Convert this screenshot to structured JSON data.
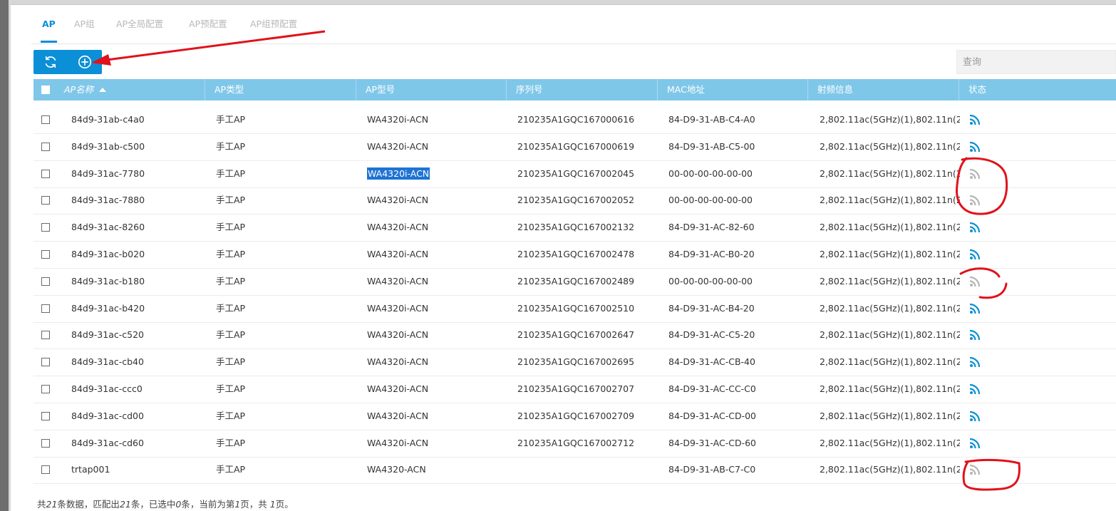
{
  "tabs": [
    "AP",
    "AP组",
    "AP全局配置",
    "AP预配置",
    "AP组预配置"
  ],
  "active_tab": "AP",
  "toolbar": {
    "refresh_icon": "refresh-icon",
    "add_icon": "add-circle-icon"
  },
  "search": {
    "placeholder": "查询"
  },
  "table": {
    "columns": [
      "AP名称",
      "AP类型",
      "AP型号",
      "序列号",
      "MAC地址",
      "射频信息",
      "状态"
    ],
    "sorted_column": "AP名称",
    "rows": [
      {
        "name": "84d9-31ab-c4a0",
        "type": "手工AP",
        "model": "WA4320i-ACN",
        "serial": "210235A1GQC167000616",
        "mac": "84-D9-31-AB-C4-A0",
        "radio": "2,802.11ac(5GHz)(1),802.11n(2...",
        "status": "online"
      },
      {
        "name": "84d9-31ab-c500",
        "type": "手工AP",
        "model": "WA4320i-ACN",
        "serial": "210235A1GQC167000619",
        "mac": "84-D9-31-AB-C5-00",
        "radio": "2,802.11ac(5GHz)(1),802.11n(2...",
        "status": "online"
      },
      {
        "name": "84d9-31ac-7780",
        "type": "手工AP",
        "model": "WA4320i-ACN",
        "serial": "210235A1GQC167002045",
        "mac": "00-00-00-00-00-00",
        "radio": "2,802.11ac(5GHz)(1),802.11n(2...",
        "status": "offline",
        "highlight_model": true
      },
      {
        "name": "84d9-31ac-7880",
        "type": "手工AP",
        "model": "WA4320i-ACN",
        "serial": "210235A1GQC167002052",
        "mac": "00-00-00-00-00-00",
        "radio": "2,802.11ac(5GHz)(1),802.11n(2...",
        "status": "offline"
      },
      {
        "name": "84d9-31ac-8260",
        "type": "手工AP",
        "model": "WA4320i-ACN",
        "serial": "210235A1GQC167002132",
        "mac": "84-D9-31-AC-82-60",
        "radio": "2,802.11ac(5GHz)(1),802.11n(2...",
        "status": "online"
      },
      {
        "name": "84d9-31ac-b020",
        "type": "手工AP",
        "model": "WA4320i-ACN",
        "serial": "210235A1GQC167002478",
        "mac": "84-D9-31-AC-B0-20",
        "radio": "2,802.11ac(5GHz)(1),802.11n(2...",
        "status": "online"
      },
      {
        "name": "84d9-31ac-b180",
        "type": "手工AP",
        "model": "WA4320i-ACN",
        "serial": "210235A1GQC167002489",
        "mac": "00-00-00-00-00-00",
        "radio": "2,802.11ac(5GHz)(1),802.11n(2...",
        "status": "offline"
      },
      {
        "name": "84d9-31ac-b420",
        "type": "手工AP",
        "model": "WA4320i-ACN",
        "serial": "210235A1GQC167002510",
        "mac": "84-D9-31-AC-B4-20",
        "radio": "2,802.11ac(5GHz)(1),802.11n(2...",
        "status": "online"
      },
      {
        "name": "84d9-31ac-c520",
        "type": "手工AP",
        "model": "WA4320i-ACN",
        "serial": "210235A1GQC167002647",
        "mac": "84-D9-31-AC-C5-20",
        "radio": "2,802.11ac(5GHz)(1),802.11n(2...",
        "status": "online"
      },
      {
        "name": "84d9-31ac-cb40",
        "type": "手工AP",
        "model": "WA4320i-ACN",
        "serial": "210235A1GQC167002695",
        "mac": "84-D9-31-AC-CB-40",
        "radio": "2,802.11ac(5GHz)(1),802.11n(2...",
        "status": "online"
      },
      {
        "name": "84d9-31ac-ccc0",
        "type": "手工AP",
        "model": "WA4320i-ACN",
        "serial": "210235A1GQC167002707",
        "mac": "84-D9-31-AC-CC-C0",
        "radio": "2,802.11ac(5GHz)(1),802.11n(2...",
        "status": "online"
      },
      {
        "name": "84d9-31ac-cd00",
        "type": "手工AP",
        "model": "WA4320i-ACN",
        "serial": "210235A1GQC167002709",
        "mac": "84-D9-31-AC-CD-00",
        "radio": "2,802.11ac(5GHz)(1),802.11n(2...",
        "status": "online"
      },
      {
        "name": "84d9-31ac-cd60",
        "type": "手工AP",
        "model": "WA4320i-ACN",
        "serial": "210235A1GQC167002712",
        "mac": "84-D9-31-AC-CD-60",
        "radio": "2,802.11ac(5GHz)(1),802.11n(2...",
        "status": "online"
      },
      {
        "name": "trtap001",
        "type": "手工AP",
        "model": "WA4320-ACN",
        "serial": "",
        "mac": "84-D9-31-AB-C7-C0",
        "radio": "2,802.11ac(5GHz)(1),802.11n(2...",
        "status": "offline"
      }
    ]
  },
  "footer": {
    "p1": "共",
    "total": "21",
    "p2": "条数据，匹配出",
    "matched": "21",
    "p3": "条，已选中",
    "selected": "0",
    "p4": "条，当前为第",
    "page": "1",
    "p5": "页，共 ",
    "pages": "1",
    "p6": "页。"
  },
  "colors": {
    "accent": "#0b8fd6",
    "header_bg": "#7fc7e9",
    "online": "#0b8fd6",
    "offline": "#b5b5b5",
    "annotation": "#e0121b"
  }
}
